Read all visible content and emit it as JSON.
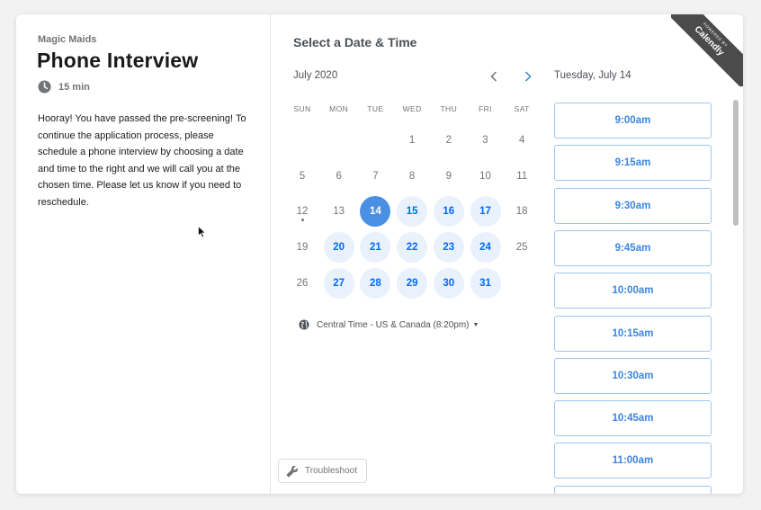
{
  "event": {
    "org_name": "Magic Maids",
    "title": "Phone Interview",
    "duration": "15 min",
    "description": "Hooray! You have passed the pre-screening! To continue the application process, please schedule a phone interview by choosing a date and time to the right and we will call you at the chosen time. Please let us know if you need to reschedule."
  },
  "calendar": {
    "heading": "Select a Date & Time",
    "month_label": "July 2020",
    "weekdays": [
      "SUN",
      "MON",
      "TUE",
      "WED",
      "THU",
      "FRI",
      "SAT"
    ],
    "days": [
      {
        "n": "1",
        "state": "plain"
      },
      {
        "n": "2",
        "state": "plain"
      },
      {
        "n": "3",
        "state": "plain"
      },
      {
        "n": "4",
        "state": "plain"
      },
      {
        "n": "5",
        "state": "plain"
      },
      {
        "n": "6",
        "state": "plain"
      },
      {
        "n": "7",
        "state": "plain"
      },
      {
        "n": "8",
        "state": "plain"
      },
      {
        "n": "9",
        "state": "plain"
      },
      {
        "n": "10",
        "state": "plain"
      },
      {
        "n": "11",
        "state": "plain"
      },
      {
        "n": "12",
        "state": "today"
      },
      {
        "n": "13",
        "state": "plain"
      },
      {
        "n": "14",
        "state": "selected"
      },
      {
        "n": "15",
        "state": "available"
      },
      {
        "n": "16",
        "state": "available"
      },
      {
        "n": "17",
        "state": "available"
      },
      {
        "n": "18",
        "state": "plain"
      },
      {
        "n": "19",
        "state": "plain"
      },
      {
        "n": "20",
        "state": "available"
      },
      {
        "n": "21",
        "state": "available"
      },
      {
        "n": "22",
        "state": "available"
      },
      {
        "n": "23",
        "state": "available"
      },
      {
        "n": "24",
        "state": "available"
      },
      {
        "n": "25",
        "state": "plain"
      },
      {
        "n": "26",
        "state": "plain"
      },
      {
        "n": "27",
        "state": "available"
      },
      {
        "n": "28",
        "state": "available"
      },
      {
        "n": "29",
        "state": "available"
      },
      {
        "n": "30",
        "state": "available"
      },
      {
        "n": "31",
        "state": "available"
      }
    ],
    "first_weekday_index": 3,
    "timezone": "Central Time - US & Canada (8:20pm)"
  },
  "times": {
    "date_heading": "Tuesday, July 14",
    "slots": [
      "9:00am",
      "9:15am",
      "9:30am",
      "9:45am",
      "10:00am",
      "10:15am",
      "10:30am",
      "10:45am",
      "11:00am",
      ""
    ]
  },
  "footer": {
    "troubleshoot_label": "Troubleshoot"
  },
  "badge": {
    "line1": "POWERED BY",
    "brand": "Calendly"
  },
  "colors": {
    "accent": "#0069ff",
    "available_bg": "#e9f1fc",
    "slot_border": "#9ec6f3"
  },
  "icons": {
    "duration": "clock-icon",
    "prev": "chevron-left-icon",
    "next": "chevron-right-icon",
    "timezone": "globe-icon",
    "troubleshoot": "wrench-icon"
  }
}
